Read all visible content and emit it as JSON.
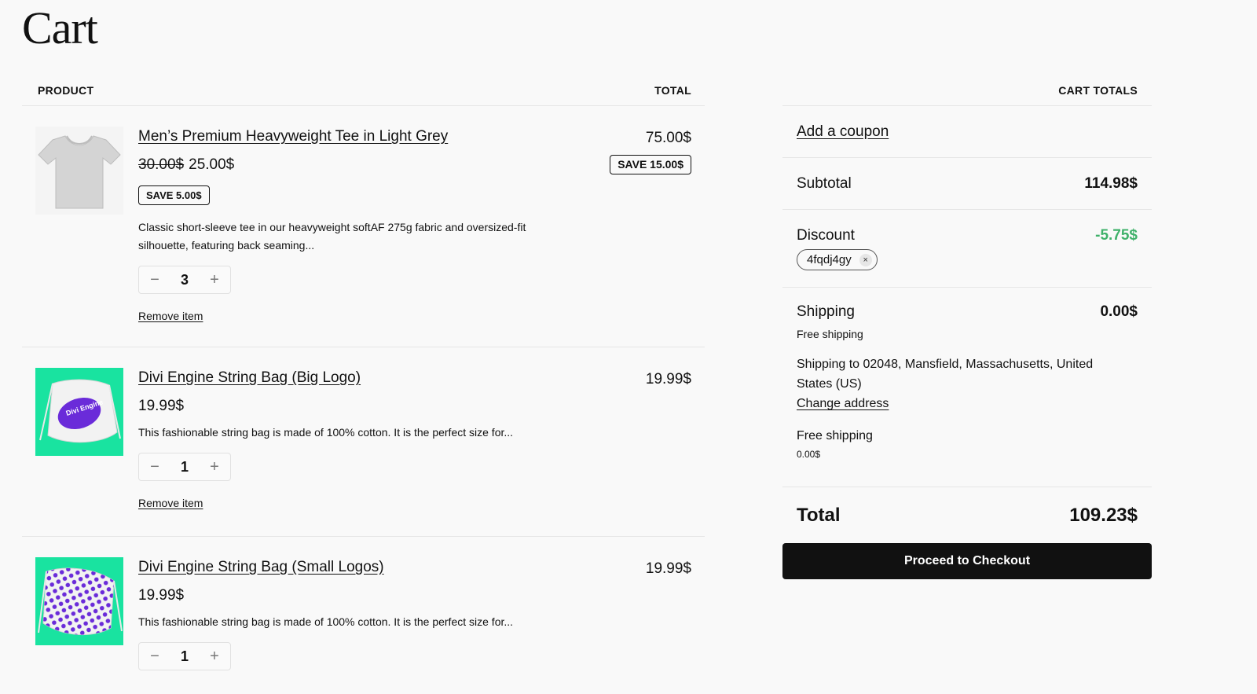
{
  "page": {
    "title": "Cart"
  },
  "table": {
    "product_header": "PRODUCT",
    "total_header": "TOTAL"
  },
  "items": [
    {
      "name": "Men’s Premium Heavyweight Tee in Light Grey",
      "price_old": "30.00$",
      "price": "25.00$",
      "save": "SAVE 5.00$",
      "description": "Classic short-sleeve tee in our heavyweight softAF 275g fabric and oversized-fit silhouette, featuring back seaming...",
      "quantity": "3",
      "remove_label": "Remove item",
      "total": "75.00$",
      "total_save": "SAVE 15.00$",
      "image_icon": "tshirt-image"
    },
    {
      "name": "Divi Engine String Bag (Big Logo)",
      "price": "19.99$",
      "description": "This fashionable string bag is made of 100% cotton. It is the perfect size for...",
      "quantity": "1",
      "remove_label": "Remove item",
      "total": "19.99$",
      "image_icon": "string-bag-big-logo-image",
      "logo_text": "Divi Engine"
    },
    {
      "name": "Divi Engine String Bag (Small Logos)",
      "price": "19.99$",
      "description": "This fashionable string bag is made of 100% cotton. It is the perfect size for...",
      "quantity": "1",
      "total": "19.99$",
      "image_icon": "string-bag-small-logos-image"
    }
  ],
  "qty_controls": {
    "minus": "−",
    "plus": "+"
  },
  "totals": {
    "header": "CART TOTALS",
    "coupon_link": "Add a coupon",
    "subtotal_label": "Subtotal",
    "subtotal": "114.98$",
    "discount_label": "Discount",
    "discount": "-5.75$",
    "coupon_code": "4fqdj4gy",
    "coupon_remove": "×",
    "shipping_label": "Shipping",
    "shipping": "0.00$",
    "shipping_method": "Free shipping",
    "shipping_to": "Shipping to 02048, Mansfield, Massachusetts, United States (US)",
    "change_address": "Change address",
    "option_label": "Free shipping",
    "option_price": "0.00$",
    "total_label": "Total",
    "total": "109.23$",
    "checkout_label": "Proceed to Checkout"
  },
  "colors": {
    "accent_green": "#3fb16a",
    "bag_bg": "#19e3a0",
    "button_bg": "#111111"
  }
}
